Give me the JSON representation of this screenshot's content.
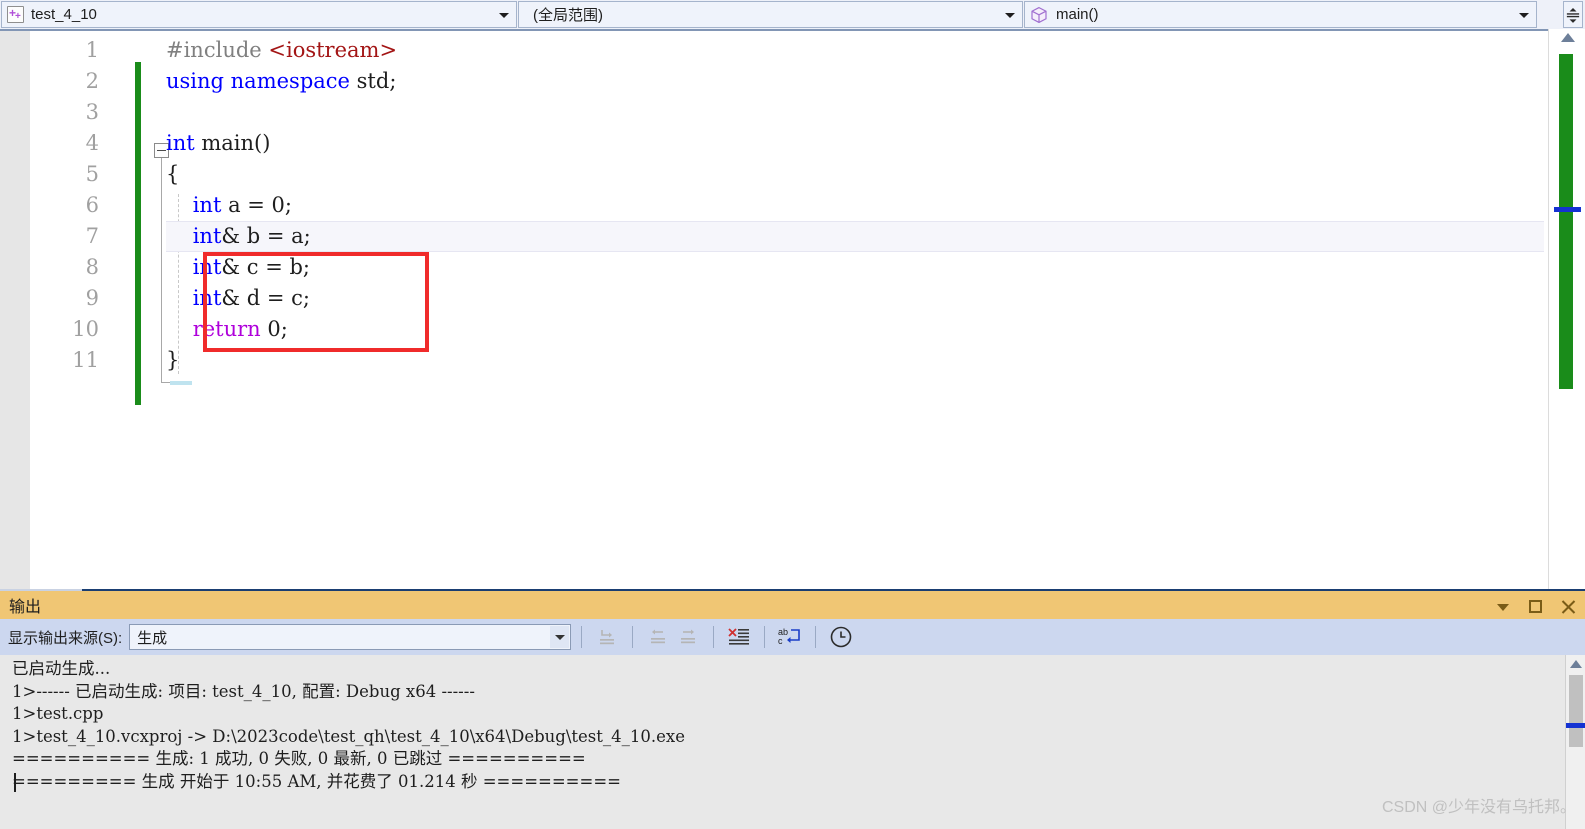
{
  "navbar": {
    "project_combo": {
      "icon": "cpp-file-icon",
      "value": "test_4_10"
    },
    "scope_combo": {
      "value": "(全局范围)"
    },
    "member_combo": {
      "icon": "cube-icon",
      "value": "main()"
    },
    "updown_icon": "up-down-split-icon"
  },
  "editor": {
    "line_numbers": [
      "1",
      "2",
      "3",
      "4",
      "5",
      "6",
      "7",
      "8",
      "9",
      "10",
      "11"
    ],
    "current_line": 7,
    "lines": [
      {
        "n": 1,
        "segments": [
          {
            "t": "#include ",
            "c": "tok-pre"
          },
          {
            "t": "<iostream>",
            "c": "tok-str"
          }
        ]
      },
      {
        "n": 2,
        "segments": [
          {
            "t": "using namespace ",
            "c": "tok-kw"
          },
          {
            "t": "std;",
            "c": "tok-plain"
          }
        ]
      },
      {
        "n": 3,
        "segments": []
      },
      {
        "n": 4,
        "segments": [
          {
            "t": "int ",
            "c": "tok-kw"
          },
          {
            "t": "main()",
            "c": "tok-plain"
          }
        ]
      },
      {
        "n": 5,
        "segments": [
          {
            "t": "{",
            "c": "tok-plain"
          }
        ]
      },
      {
        "n": 6,
        "segments": [
          {
            "t": "    ",
            "c": "tok-plain"
          },
          {
            "t": "int",
            "c": "tok-kw"
          },
          {
            "t": " a = 0;",
            "c": "tok-plain"
          }
        ]
      },
      {
        "n": 7,
        "segments": [
          {
            "t": "    ",
            "c": "tok-plain"
          },
          {
            "t": "int",
            "c": "tok-kw"
          },
          {
            "t": "& b = a;",
            "c": "tok-plain"
          }
        ]
      },
      {
        "n": 8,
        "segments": [
          {
            "t": "    ",
            "c": "tok-plain"
          },
          {
            "t": "int",
            "c": "tok-kw"
          },
          {
            "t": "& c = b;",
            "c": "tok-plain"
          }
        ]
      },
      {
        "n": 9,
        "segments": [
          {
            "t": "    ",
            "c": "tok-plain"
          },
          {
            "t": "int",
            "c": "tok-kw"
          },
          {
            "t": "& d = c;",
            "c": "tok-plain"
          }
        ]
      },
      {
        "n": 10,
        "segments": [
          {
            "t": "    ",
            "c": "tok-plain"
          },
          {
            "t": "return",
            "c": "tok-kwp"
          },
          {
            "t": " 0;",
            "c": "tok-plain"
          }
        ]
      },
      {
        "n": 11,
        "segments": [
          {
            "t": "}",
            "c": "tok-plain"
          }
        ]
      }
    ],
    "annotation": {
      "shape": "rectangle",
      "color": "#f02b2b",
      "covers_lines": "7-9"
    },
    "change_bar_color": "#1a8c1a",
    "scrollbar": {
      "thumb_color": "#1a8c1a",
      "marker_color": "#1432d2"
    }
  },
  "output": {
    "title": "输出",
    "header_buttons": [
      "dropdown",
      "maximize",
      "close"
    ],
    "source_label": "显示输出来源(S):",
    "source_value": "生成",
    "toolbar_icons": [
      "go-to-message-icon",
      "previous-message-icon",
      "next-message-icon",
      "clear-all-icon",
      "toggle-word-wrap-icon",
      "show-output-history-icon"
    ],
    "text": "已启动生成...\n1>------ 已启动生成: 项目: test_4_10, 配置: Debug x64 ------\n1>test.cpp\n1>test_4_10.vcxproj -> D:\\2023code\\test_qh\\test_4_10\\x64\\Debug\\test_4_10.exe\n========== 生成: 1 成功, 0 失败, 0 最新, 0 已跳过 ==========\n========= 生成 开始于 10:55 AM, 并花费了 01.214 秒 ==========",
    "build_summary": {
      "project": "test_4_10",
      "configuration": "Debug x64",
      "source_file": "test.cpp",
      "output_path": "D:\\2023code\\test_qh\\test_4_10\\x64\\Debug\\test_4_10.exe",
      "succeeded": 1,
      "failed": 0,
      "up_to_date": 0,
      "skipped": 0,
      "start_time": "10:55 AM",
      "elapsed": "01.214 秒"
    }
  },
  "watermark": "CSDN @少年没有乌托邦。",
  "colors": {
    "output_header": "#f0c674",
    "toolbar": "#ccd7ef",
    "annotation_red": "#f02b2b",
    "change_bar_green": "#1a8c1a",
    "marker_blue": "#1432d2"
  }
}
